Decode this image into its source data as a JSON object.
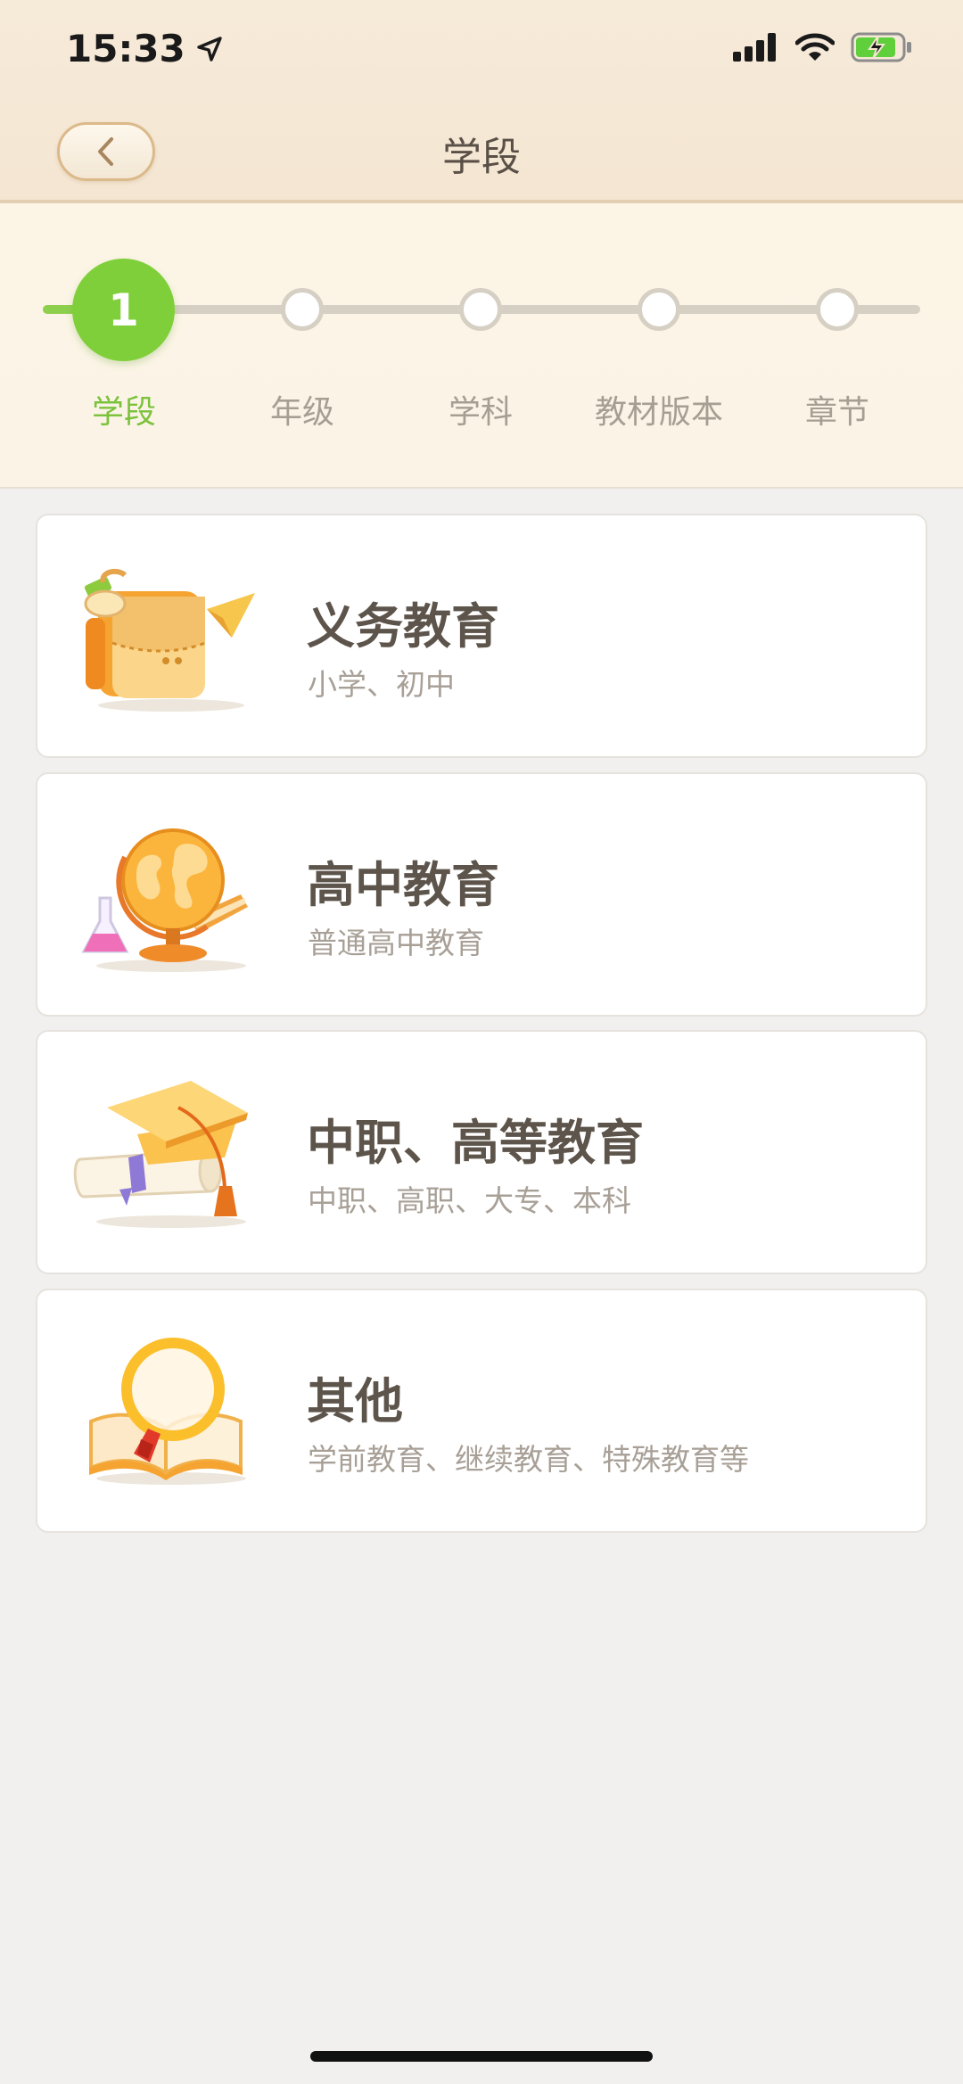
{
  "status_bar": {
    "time": "15:33",
    "location_icon": "location-arrow-icon",
    "signal_icon": "cellular-signal-icon",
    "wifi_icon": "wifi-icon",
    "battery_icon": "battery-charging-icon"
  },
  "header": {
    "title": "学段",
    "back_icon": "chevron-left-icon"
  },
  "stepper": {
    "current_step": "1",
    "steps": [
      {
        "label": "学段",
        "active": true
      },
      {
        "label": "年级",
        "active": false
      },
      {
        "label": "学科",
        "active": false
      },
      {
        "label": "教材版本",
        "active": false
      },
      {
        "label": "章节",
        "active": false
      }
    ]
  },
  "options": [
    {
      "title": "义务教育",
      "subtitle": "小学、初中",
      "icon": "school-bag-icon"
    },
    {
      "title": "高中教育",
      "subtitle": "普通高中教育",
      "icon": "globe-icon"
    },
    {
      "title": "中职、高等教育",
      "subtitle": "中职、高职、大专、本科",
      "icon": "graduation-cap-icon"
    },
    {
      "title": "其他",
      "subtitle": "学前教育、继续教育、特殊教育等",
      "icon": "magnifier-book-icon"
    }
  ],
  "colors": {
    "accent_green": "#7fcf3a",
    "header_bg": "#f6ead9",
    "step_inactive": "#d6d0c4",
    "title_text": "#5d544b",
    "sub_text": "#a8a097"
  }
}
